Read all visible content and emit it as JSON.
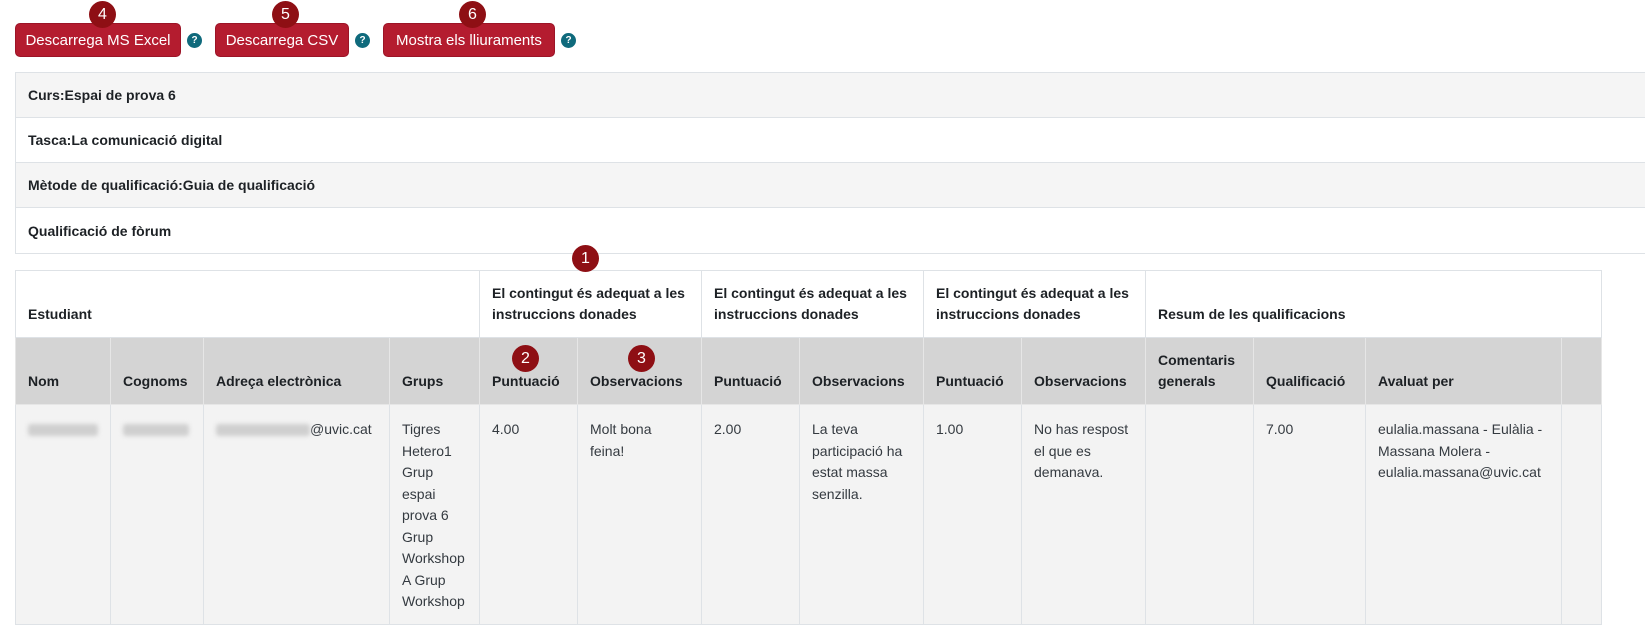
{
  "toolbar": {
    "excel_label": "Descarrega MS Excel",
    "csv_label": "Descarrega CSV",
    "show_label": "Mostra els lliuraments",
    "help_glyph": "?"
  },
  "badges": [
    "1",
    "2",
    "3",
    "4",
    "5",
    "6"
  ],
  "info": {
    "course": "Curs:Espai de prova 6",
    "task": "Tasca:La comunicació digital",
    "method": "Mètode de qualificació:Guia de qualificació",
    "forum": "Qualificació de fòrum"
  },
  "table": {
    "group_headers": {
      "student": "Estudiant",
      "criterion_1": "El contingut és adequat a les instruccions donades",
      "criterion_2": "El contingut és adequat a les instruccions donades",
      "criterion_3": "El contingut és adequat a les instruccions donades",
      "summary": "Resum de les qualificacions"
    },
    "columns": {
      "name": "Nom",
      "surname": "Cognoms",
      "email": "Adreça electrònica",
      "groups": "Grups",
      "score": "Puntuació",
      "observations": "Observacions",
      "general_comments": "Comentaris generals",
      "grade": "Qualificació",
      "graded_by": "Avaluat per"
    },
    "row": {
      "email_domain": "@uvic.cat",
      "groups": "Tigres Hetero1 Grup espai prova 6 Grup Workshop A Grup Workshop",
      "score_1": "4.00",
      "obs_1": "Molt bona feina!",
      "score_2": "2.00",
      "obs_2": "La teva participació ha estat massa senzilla.",
      "score_3": "1.00",
      "obs_3": "No has respost el que es demanava.",
      "general_comments": "",
      "grade": "7.00",
      "graded_by": "eulalia.massana - Eulàlia - Massana Molera - eulalia.massana@uvic.cat"
    }
  }
}
